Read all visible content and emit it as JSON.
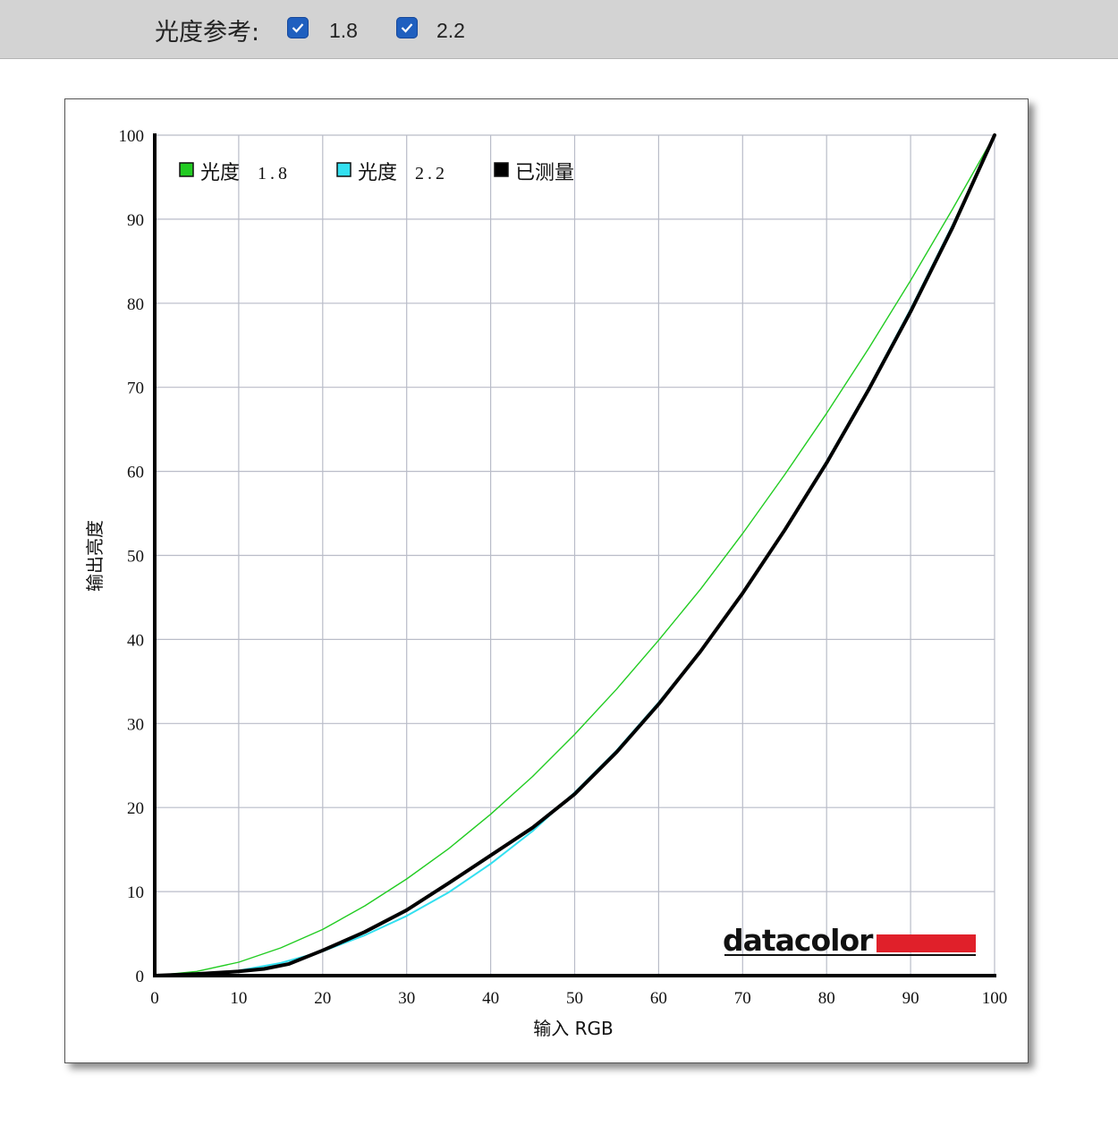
{
  "toolbar": {
    "label": "光度参考:",
    "option1": "1.8",
    "option2": "2.2",
    "accent": "#1f5fbf"
  },
  "chart_data": {
    "type": "line",
    "xlabel": "输入 RGB",
    "ylabel": "输出亮度",
    "xlim": [
      0,
      100
    ],
    "ylim": [
      0,
      100
    ],
    "xticks": [
      "0",
      "10",
      "20",
      "30",
      "40",
      "50",
      "60",
      "70",
      "80",
      "90",
      "100"
    ],
    "yticks": [
      "0",
      "10",
      "20",
      "30",
      "40",
      "50",
      "60",
      "70",
      "80",
      "90",
      "100"
    ],
    "grid": true,
    "legend_position": "top-left",
    "legend": [
      {
        "label": "光度",
        "value": "1.8",
        "color": "#22cc22"
      },
      {
        "label": "光度",
        "value": "2.2",
        "color": "#33e0f0"
      },
      {
        "label": "已测量",
        "value": "",
        "color": "#000000"
      }
    ],
    "series": [
      {
        "name": "光度 1.8",
        "color": "#22cc22",
        "x": [
          0,
          5,
          10,
          15,
          20,
          25,
          30,
          35,
          40,
          45,
          50,
          55,
          60,
          65,
          70,
          75,
          80,
          85,
          90,
          95,
          100
        ],
        "y": [
          0,
          0.5,
          1.6,
          3.3,
          5.5,
          8.3,
          11.5,
          15.1,
          19.2,
          23.7,
          28.7,
          34.1,
          39.9,
          46.0,
          52.6,
          59.6,
          66.9,
          74.6,
          82.7,
          91.2,
          100
        ]
      },
      {
        "name": "光度 2.2",
        "color": "#33e0f0",
        "x": [
          0,
          5,
          10,
          15,
          20,
          25,
          30,
          35,
          40,
          45,
          50,
          55,
          60,
          65,
          70,
          75,
          80,
          85,
          90,
          95,
          100
        ],
        "y": [
          0,
          0.1,
          0.6,
          1.5,
          2.9,
          4.8,
          7.1,
          9.9,
          13.3,
          17.2,
          21.8,
          26.8,
          32.5,
          38.7,
          45.6,
          53.1,
          61.2,
          69.9,
          79.3,
          89.3,
          100
        ]
      },
      {
        "name": "已测量",
        "color": "#000000",
        "x": [
          0,
          5,
          10,
          13,
          16,
          20,
          25,
          30,
          35,
          40,
          45,
          50,
          55,
          60,
          65,
          70,
          75,
          80,
          85,
          90,
          95,
          100
        ],
        "y": [
          0,
          0.2,
          0.5,
          0.8,
          1.4,
          3.0,
          5.2,
          7.8,
          11.0,
          14.3,
          17.6,
          21.6,
          26.6,
          32.3,
          38.6,
          45.5,
          53.0,
          61.0,
          69.7,
          79.0,
          89.0,
          100
        ]
      }
    ],
    "brand": {
      "text": "datacolor",
      "bar_color": "#e0202a"
    }
  }
}
